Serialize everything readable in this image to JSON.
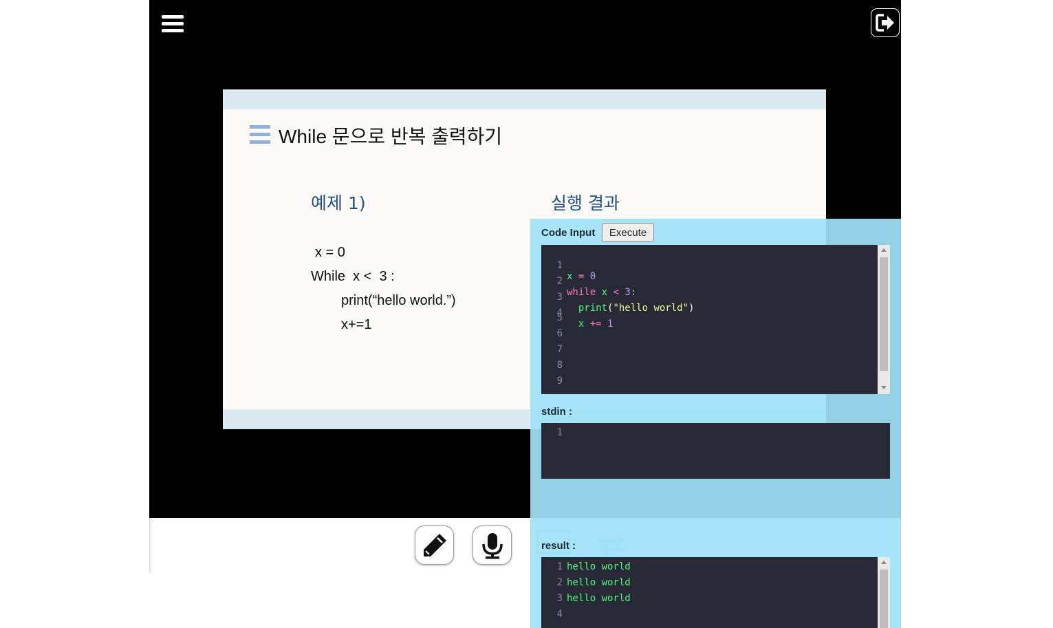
{
  "icons": {
    "menu": "hamburger-menu-icon",
    "exit": "exit-door-arrow-icon",
    "pencil": "pencil-icon",
    "microphone": "microphone-icon",
    "screen": "screen-share-icon",
    "swap": "swap-arrows-icon"
  },
  "colors": {
    "stage_bg": "#000000",
    "slide_bg": "#fdfaf7",
    "slide_band": "#dbeaf1",
    "slide_heading": "#1f4e8c",
    "panel_bg": "#a0e2f6",
    "editor_bg": "#272a36"
  },
  "slide": {
    "title": "While 문으로 반복 출력하기",
    "example_heading": "예제 1)",
    "result_heading": "실행 결과",
    "code": [
      "x = 0",
      "While  x <  3 :",
      "print(“hello world.”)",
      "x+=1"
    ]
  },
  "code_panel": {
    "code_input_label": "Code Input",
    "execute_label": "Execute",
    "editor_line_numbers": [
      "1",
      "2",
      "3",
      "4",
      "5",
      "6",
      "7",
      "8",
      "9"
    ],
    "editor_code": {
      "line1": {
        "var": "x",
        "op": " = ",
        "num": "0"
      },
      "line2": {
        "kw": "while",
        "mid": " x ",
        "op": "<",
        "num": " 3",
        "end": ":"
      },
      "line3": {
        "fn": "  print",
        "open": "(",
        "str": "\"hello world\"",
        "close": ")"
      },
      "line4": {
        "var": "  x",
        "op": " += ",
        "num": "1"
      }
    },
    "stdin_label": "stdin :",
    "stdin_line_numbers": [
      "1"
    ],
    "result_label": "result :",
    "result_line_numbers": [
      "1",
      "2",
      "3",
      "4"
    ],
    "result_lines": [
      "hello world",
      "hello world",
      "hello world",
      ""
    ]
  }
}
